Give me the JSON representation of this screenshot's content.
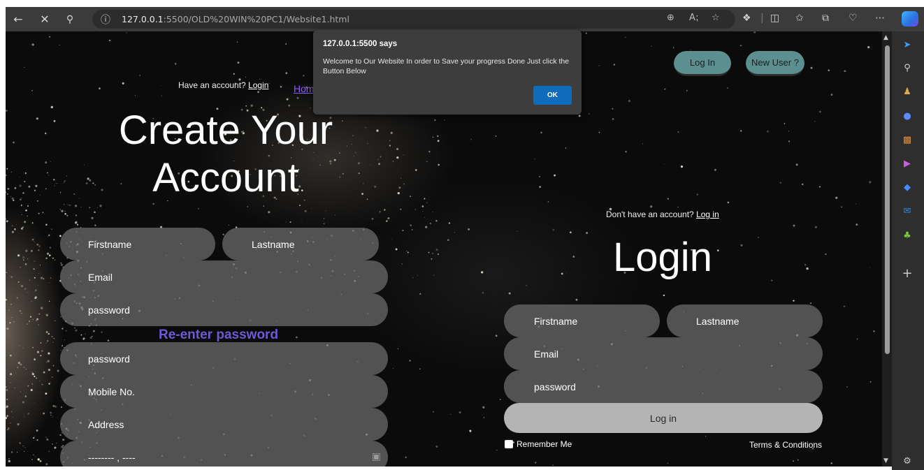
{
  "browser": {
    "url_host": "127.0.0.1",
    "url_rest": ":5500/OLD%20WIN%20PC1/Website1.html"
  },
  "header": {
    "login_button": "Log In",
    "new_user_button": "New User ?"
  },
  "signup": {
    "have_account_text": "Have an account?",
    "login_link": "Login",
    "home_link": "Hom",
    "title": "Create Your Account",
    "firstname_placeholder": "Firstname",
    "lastname_placeholder": "Lastname",
    "email_placeholder": "Email",
    "password_placeholder": "password",
    "reenter_label": "Re-enter password",
    "reenter_placeholder": "password",
    "mobile_placeholder": "Mobile No.",
    "address_placeholder": "Address",
    "date_placeholder": "-------- , ----"
  },
  "login": {
    "dont_have_text": "Don't have an account?",
    "login_link": "Log in",
    "title": "Login",
    "firstname_placeholder": "Firstname",
    "lastname_placeholder": "Lastname",
    "email_placeholder": "Email",
    "password_placeholder": "password",
    "submit_label": "Log in",
    "remember_label": "Remember Me",
    "terms_label": "Terms & Conditions"
  },
  "dialog": {
    "title": "127.0.0.1:5500 says",
    "message": "Welcome to Our Website In order to Save your progress Done Just click the Button Below",
    "ok_label": "OK"
  },
  "icons": {
    "back": "arrow-left-icon",
    "stop": "close-icon",
    "search": "search-icon",
    "info": "info-icon",
    "zoom": "zoom-icon",
    "read_aloud": "read-aloud-icon",
    "favorite": "star-icon",
    "extensions": "puzzle-icon",
    "split": "split-screen-icon",
    "favorites_bar": "favorites-icon",
    "collections": "collections-icon",
    "health": "heart-icon",
    "more": "more-icon",
    "copilot": "copilot-icon"
  },
  "colors": {
    "accent_teal": "#5c9090",
    "reenter_purple": "#6d5bd6",
    "home_link": "#8a5cff",
    "ok_button": "#0f6cbd"
  }
}
